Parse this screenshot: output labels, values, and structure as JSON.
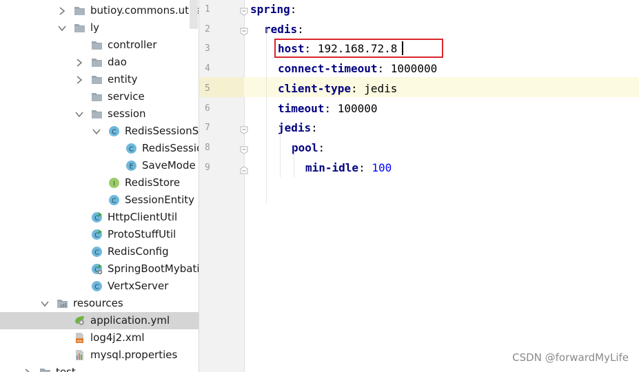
{
  "tree": {
    "rows": [
      {
        "label": "butioy.commons.utils",
        "indent": 0,
        "arrow": "right",
        "icon": "folder"
      },
      {
        "label": "ly",
        "indent": 0,
        "arrow": "down",
        "icon": "folder"
      },
      {
        "label": "controller",
        "indent": 1,
        "arrow": "",
        "icon": "folder"
      },
      {
        "label": "dao",
        "indent": 1,
        "arrow": "right",
        "icon": "folder"
      },
      {
        "label": "entity",
        "indent": 1,
        "arrow": "right",
        "icon": "folder"
      },
      {
        "label": "service",
        "indent": 1,
        "arrow": "",
        "icon": "folder"
      },
      {
        "label": "session",
        "indent": 1,
        "arrow": "down",
        "icon": "folder"
      },
      {
        "label": "RedisSessionSt",
        "indent": 2,
        "arrow": "down",
        "icon": "class"
      },
      {
        "label": "RedisSessio",
        "indent": 3,
        "arrow": "",
        "icon": "class"
      },
      {
        "label": "SaveMode",
        "indent": 3,
        "arrow": "",
        "icon": "enum"
      },
      {
        "label": "RedisStore",
        "indent": 2,
        "arrow": "",
        "icon": "interface"
      },
      {
        "label": "SessionEntity",
        "indent": 2,
        "arrow": "",
        "icon": "class"
      },
      {
        "label": "HttpClientUtil",
        "indent": 1,
        "arrow": "",
        "icon": "class-run"
      },
      {
        "label": "ProtoStuffUtil",
        "indent": 1,
        "arrow": "",
        "icon": "class-run"
      },
      {
        "label": "RedisConfig",
        "indent": 1,
        "arrow": "",
        "icon": "class"
      },
      {
        "label": "SpringBootMybati",
        "indent": 1,
        "arrow": "",
        "icon": "class-spring"
      },
      {
        "label": "VertxServer",
        "indent": 1,
        "arrow": "",
        "icon": "class"
      },
      {
        "label": "resources",
        "indent": -1,
        "arrow": "down",
        "icon": "resources"
      },
      {
        "label": "application.yml",
        "indent": 0,
        "arrow": "",
        "icon": "yml",
        "selected": true
      },
      {
        "label": "log4j2.xml",
        "indent": 0,
        "arrow": "",
        "icon": "xml"
      },
      {
        "label": "mysql.properties",
        "indent": 0,
        "arrow": "",
        "icon": "props"
      },
      {
        "label": "test",
        "indent": -2,
        "arrow": "right",
        "icon": "folder"
      }
    ]
  },
  "editor": {
    "lines": [
      {
        "num": "1",
        "indent": 0,
        "key": "spring",
        "value": "",
        "vtype": "",
        "fold": "open"
      },
      {
        "num": "2",
        "indent": 1,
        "key": "redis",
        "value": "",
        "vtype": "",
        "fold": "open"
      },
      {
        "num": "3",
        "indent": 2,
        "key": "host",
        "value": "192.168.72.8",
        "vtype": "str",
        "fold": "",
        "current": true
      },
      {
        "num": "4",
        "indent": 2,
        "key": "connect-timeout",
        "value": "1000000",
        "vtype": "str",
        "fold": ""
      },
      {
        "num": "5",
        "indent": 2,
        "key": "client-type",
        "value": "jedis",
        "vtype": "str",
        "fold": ""
      },
      {
        "num": "6",
        "indent": 2,
        "key": "timeout",
        "value": "100000",
        "vtype": "str",
        "fold": ""
      },
      {
        "num": "7",
        "indent": 2,
        "key": "jedis",
        "value": "",
        "vtype": "",
        "fold": "open"
      },
      {
        "num": "8",
        "indent": 3,
        "key": "pool",
        "value": "",
        "vtype": "",
        "fold": "open"
      },
      {
        "num": "9",
        "indent": 4,
        "key": "min-idle",
        "value": "100",
        "vtype": "num",
        "fold": "close"
      }
    ]
  },
  "watermark": "CSDN @forwardMyLife",
  "colors": {
    "key": "#000080",
    "number": "#0000ff",
    "current_line": "#fcfae1",
    "highlight_box": "#d9262c",
    "selection": "#d5d5d5"
  }
}
